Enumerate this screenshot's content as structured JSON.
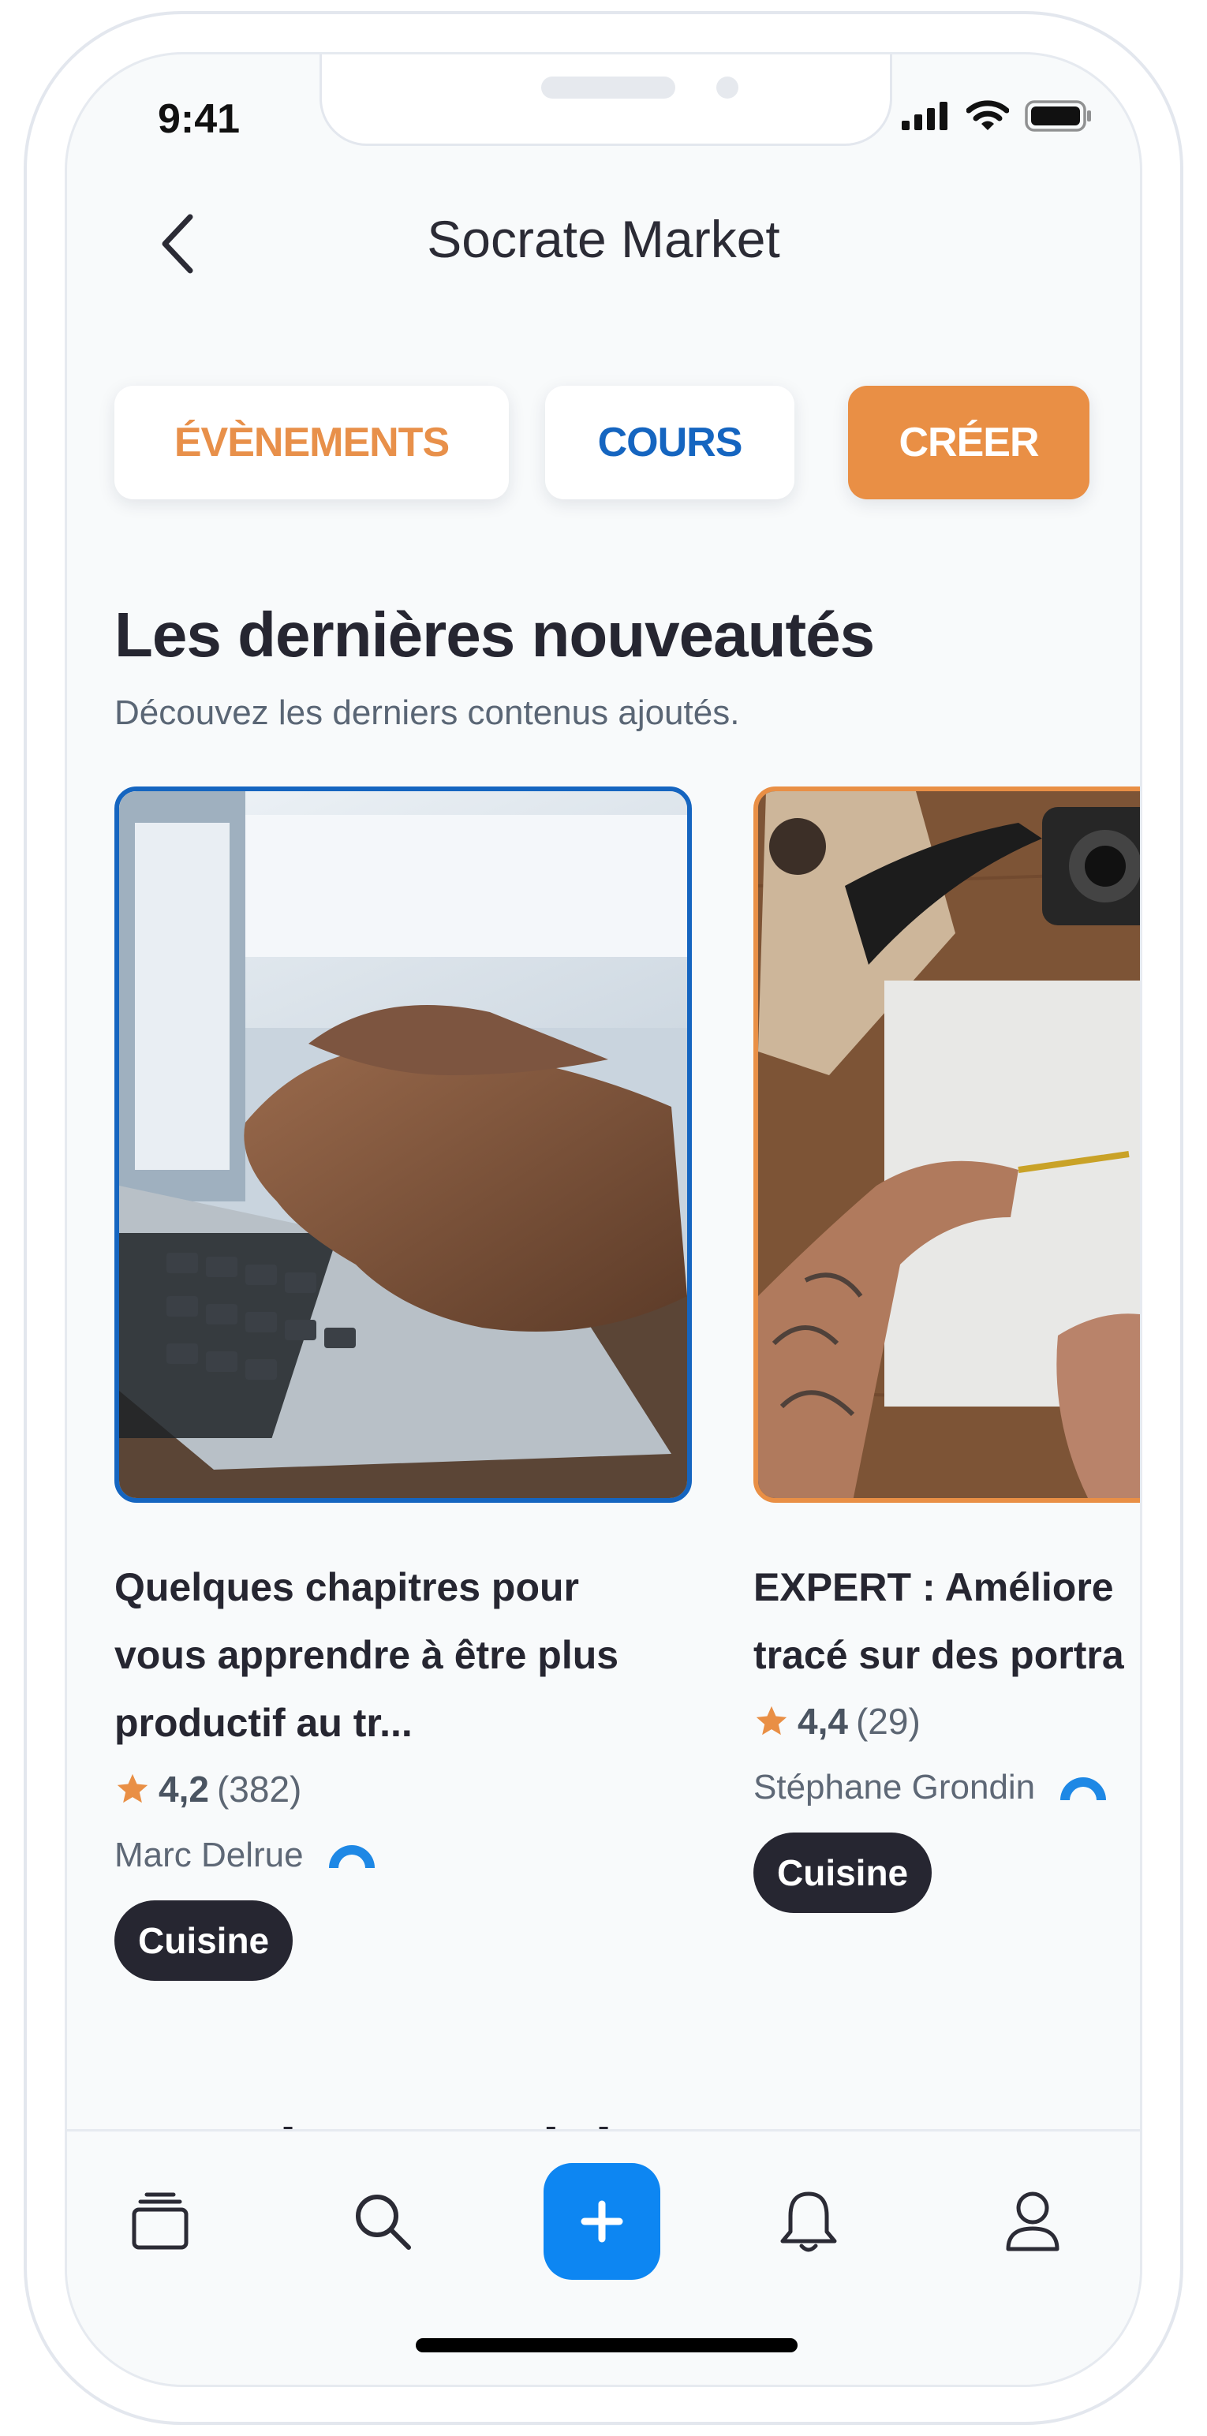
{
  "status_bar": {
    "time": "9:41"
  },
  "header": {
    "title": "Socrate Market"
  },
  "filters": {
    "events": "ÉVÈNEMENTS",
    "courses": "COURS",
    "create": "CRÉER"
  },
  "section": {
    "title": "Les dernières nouveautés",
    "subtitle": "Découvez les derniers contenus ajoutés."
  },
  "cards": [
    {
      "title_line1": "Quelques chapitres pour",
      "title_line2": "vous apprendre à être plus",
      "title_line3": "productif au tr...",
      "rating": "4,2",
      "reviews": "(382)",
      "author": "Marc Delrue",
      "tag": "Cuisine",
      "accent": "#1565c0"
    },
    {
      "title_line1": "EXPERT : Améliore",
      "title_line2": "tracé sur des portra",
      "rating": "4,4",
      "reviews": "(29)",
      "author": "Stéphane Grondin",
      "tag": "Cuisine",
      "accent": "#e98f45"
    }
  ],
  "next_section": {
    "title": "Les plus populaires"
  },
  "tabbar": {
    "items": [
      "courses-icon",
      "search-icon",
      "plus-icon",
      "bell-icon",
      "user-icon"
    ]
  },
  "colors": {
    "primary": "#0d86f2",
    "orange": "#e98f45",
    "blue": "#1565c0",
    "dark": "#262631"
  }
}
